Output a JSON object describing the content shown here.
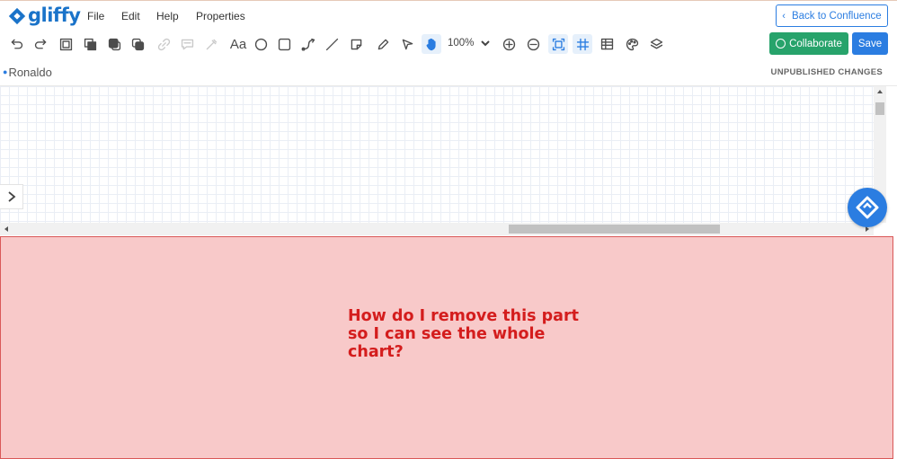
{
  "app": {
    "logo_text": "gliffy",
    "brand_color": "#1a73c9"
  },
  "menu": {
    "items": [
      {
        "label": "File"
      },
      {
        "label": "Edit"
      },
      {
        "label": "Help"
      },
      {
        "label": "Properties"
      }
    ],
    "back_label": "Back to Confluence"
  },
  "toolbar": {
    "zoom_value": "100%",
    "text_tool_label": "Aa",
    "icons": [
      "undo-icon",
      "redo-icon",
      "select-all-icon",
      "bring-forward-icon",
      "bring-to-front-icon",
      "send-to-back-icon",
      "link-icon",
      "comment-icon",
      "eyedropper-icon",
      "text-tool-icon",
      "ellipse-tool-icon",
      "rectangle-tool-icon",
      "connector-tool-icon",
      "line-tool-icon",
      "note-tool-icon",
      "pencil-tool-icon",
      "pointer-tool-icon",
      "hand-tool-icon",
      "zoom-dropdown-icon",
      "zoom-in-icon",
      "zoom-out-icon",
      "fit-to-screen-icon",
      "grid-icon",
      "table-icon",
      "theme-palette-icon",
      "layers-icon"
    ],
    "collaborate_label": "Collaborate",
    "save_label": "Save",
    "collaborate_color": "#27a36b",
    "save_color": "#2b7de1"
  },
  "document": {
    "title": "Ronaldo",
    "status": "UNPUBLISHED CHANGES"
  },
  "overlay": {
    "message": "How do I remove this part so I can see the whole chart?",
    "background": "#f8c9c9",
    "text_color": "#d41d1d"
  }
}
